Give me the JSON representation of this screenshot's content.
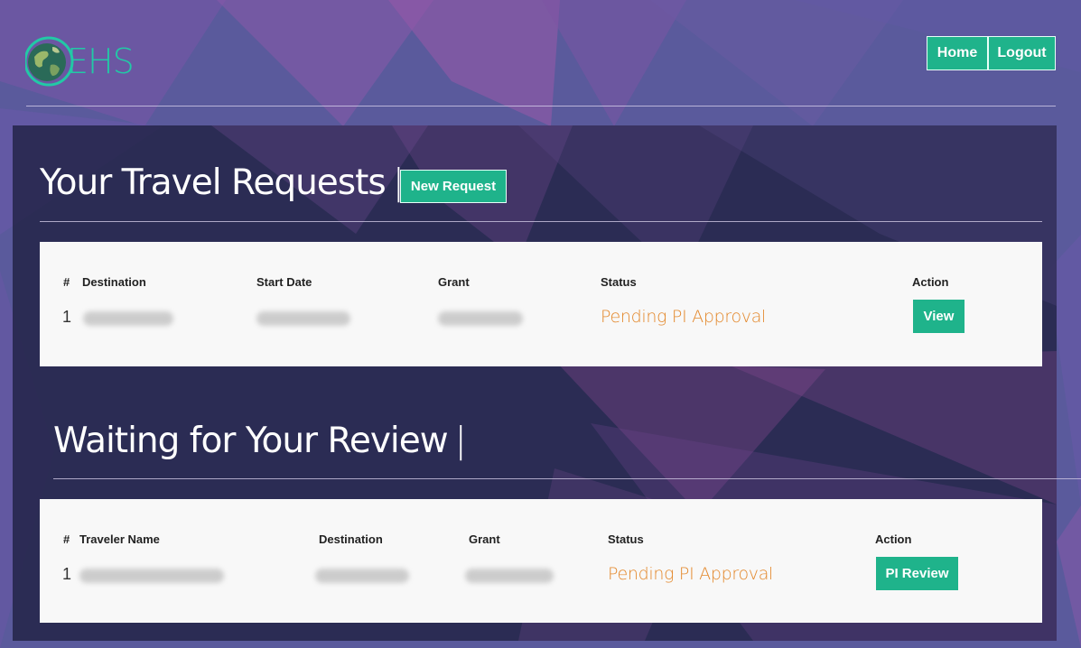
{
  "logo": {
    "text": "EHS"
  },
  "nav": {
    "home_label": "Home",
    "logout_label": "Logout"
  },
  "travel_requests": {
    "title": "Your Travel Requests",
    "separator": "|",
    "new_request_label": "New Request",
    "columns": [
      "#",
      "Destination",
      "Start Date",
      "Grant",
      "Status",
      "Action"
    ],
    "rows": [
      {
        "num": "1",
        "status": "Pending PI Approval",
        "action_label": "View"
      }
    ]
  },
  "review": {
    "title": "Waiting for Your Review",
    "separator": "|",
    "columns": [
      "#",
      "Traveler Name",
      "Destination",
      "Grant",
      "Status",
      "Action"
    ],
    "rows": [
      {
        "num": "1",
        "status": "Pending PI Approval",
        "action_label": "PI Review"
      }
    ]
  },
  "colors": {
    "accent": "#1fb38b",
    "status_pending": "#e3872a",
    "background": "#5a5a9c",
    "panel": "#1f2042",
    "logo": "#22c9a6"
  }
}
